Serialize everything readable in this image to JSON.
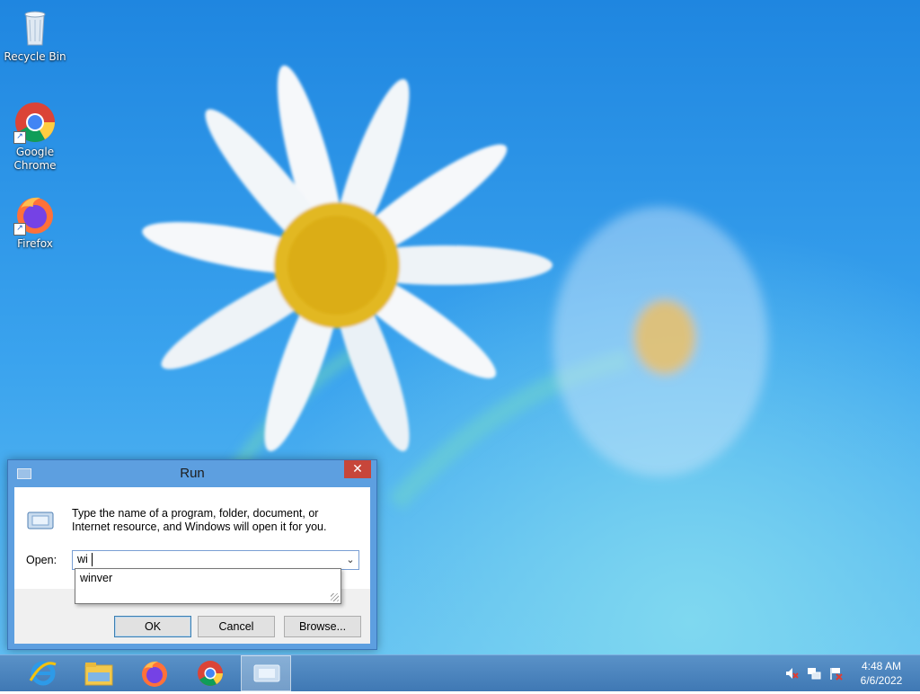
{
  "desktop": {
    "icons": [
      {
        "label": "Recycle Bin",
        "icon": "recycle-bin-icon"
      },
      {
        "label": "Google Chrome",
        "icon": "chrome-icon"
      },
      {
        "label": "Firefox",
        "icon": "firefox-icon"
      }
    ]
  },
  "run_dialog": {
    "title": "Run",
    "description": "Type the name of a program, folder, document, or Internet resource, and Windows will open it for you.",
    "open_label": "Open:",
    "input_value": "wi",
    "suggestions": [
      "winver"
    ],
    "buttons": {
      "ok": "OK",
      "cancel": "Cancel",
      "browse": "Browse..."
    }
  },
  "taskbar": {
    "apps": [
      "internet-explorer-icon",
      "file-explorer-icon",
      "firefox-icon",
      "chrome-icon",
      "run-icon"
    ],
    "tray": [
      "volume-muted-icon",
      "network-icon",
      "action-center-icon"
    ],
    "clock": {
      "time": "4:48 AM",
      "date": "6/6/2022"
    }
  },
  "colors": {
    "desktop": "#2a95e8",
    "taskbar": "#4a84be",
    "close_button": "#c7463a",
    "dialog_frame": "#5d9fe0"
  }
}
